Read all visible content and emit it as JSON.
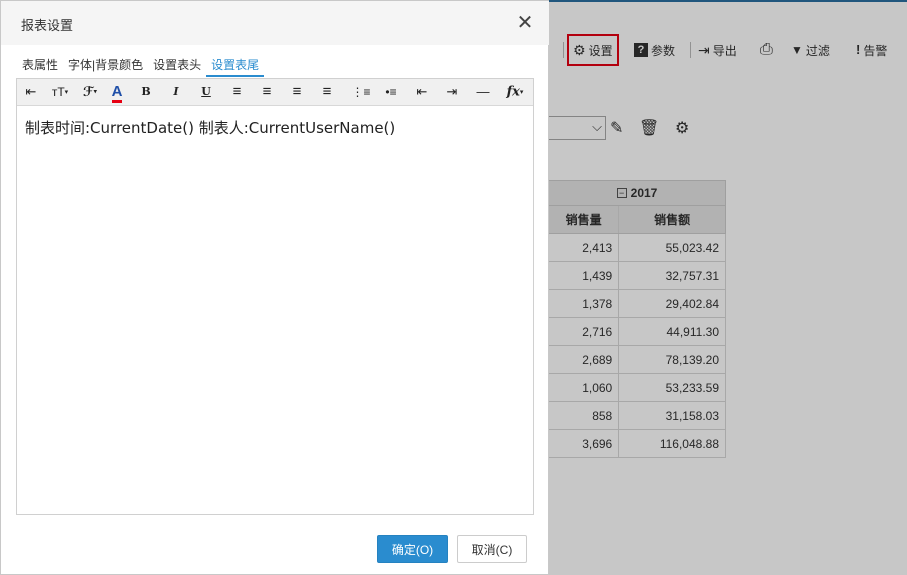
{
  "dialog": {
    "title": "报表设置",
    "close_glyph": "✕",
    "tabs": [
      {
        "label": "表属性",
        "active": false
      },
      {
        "label": "字体|背景颜色",
        "active": false
      },
      {
        "label": "设置表头",
        "active": false
      },
      {
        "label": "设置表尾",
        "active": true
      }
    ],
    "editor": {
      "toolbar": [
        {
          "name": "indent-icon",
          "glyph": "⇤"
        },
        {
          "name": "font-size-icon",
          "glyph": "тT"
        },
        {
          "name": "font-family-icon",
          "glyph": "ℱ"
        },
        {
          "name": "font-color-icon",
          "glyph": "A"
        },
        {
          "name": "bold-icon",
          "glyph": "B"
        },
        {
          "name": "italic-icon",
          "glyph": "I"
        },
        {
          "name": "underline-icon",
          "glyph": "U"
        },
        {
          "name": "align-left-icon",
          "glyph": "≡"
        },
        {
          "name": "align-center-icon",
          "glyph": "≡"
        },
        {
          "name": "align-right-icon",
          "glyph": "≡"
        },
        {
          "name": "justify-icon",
          "glyph": "≡"
        },
        {
          "name": "ordered-list-icon",
          "glyph": "⋮≡"
        },
        {
          "name": "unordered-list-icon",
          "glyph": "•≡"
        },
        {
          "name": "outdent-icon",
          "glyph": "⇤"
        },
        {
          "name": "indent-more-icon",
          "glyph": "⇥"
        },
        {
          "name": "horizontal-rule-icon",
          "glyph": "—"
        },
        {
          "name": "function-icon",
          "glyph": "fx"
        }
      ],
      "content": "制表时间:CurrentDate() 制表人:CurrentUserName()"
    },
    "ok_label": "确定(O)",
    "cancel_label": "取消(C)"
  },
  "background": {
    "toolbar": [
      {
        "label": "设置",
        "icon": "gear-icon",
        "glyph": "⚙",
        "highlighted": true
      },
      {
        "label": "参数",
        "icon": "question-icon",
        "glyph": "?"
      },
      {
        "label": "导出",
        "icon": "export-icon",
        "glyph": "⇥"
      },
      {
        "label": "",
        "icon": "print-icon",
        "glyph": "⎙"
      },
      {
        "label": "过滤",
        "icon": "filter-icon",
        "glyph": "▼"
      },
      {
        "label": "告警",
        "icon": "alert-icon",
        "glyph": "!"
      }
    ],
    "report": {
      "year": "2017",
      "collapse_glyph": "−",
      "columns": [
        "销售量",
        "销售额"
      ],
      "rows": [
        [
          "2,413",
          "55,023.42"
        ],
        [
          "1,439",
          "32,757.31"
        ],
        [
          "1,378",
          "29,402.84"
        ],
        [
          "2,716",
          "44,911.30"
        ],
        [
          "2,689",
          "78,139.20"
        ],
        [
          "1,060",
          "53,233.59"
        ],
        [
          "858",
          "31,158.03"
        ],
        [
          "3,696",
          "116,048.88"
        ]
      ]
    }
  },
  "colors": {
    "accent": "#2a8ccf",
    "highlight_border": "#e60012"
  }
}
